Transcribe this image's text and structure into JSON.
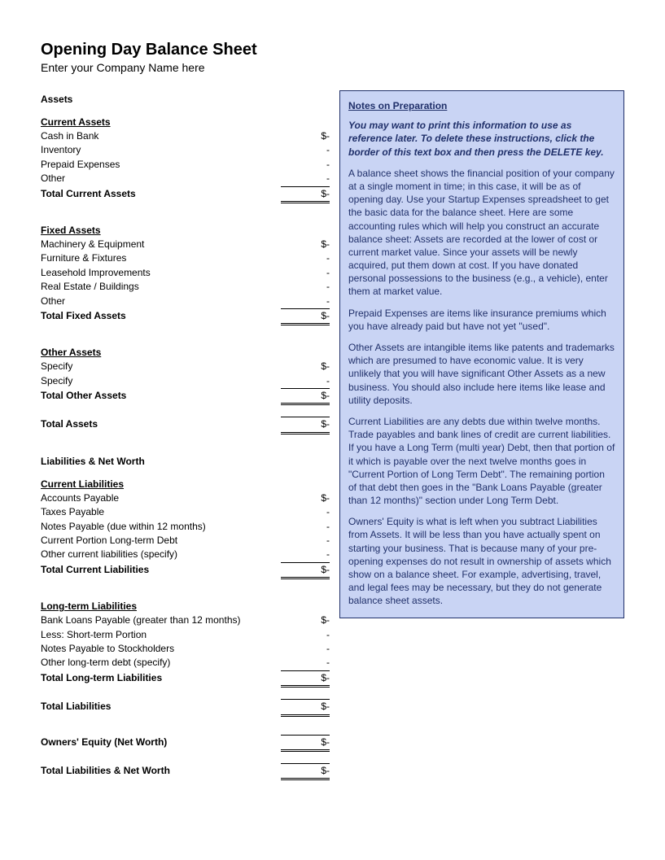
{
  "title": "Opening Day Balance Sheet",
  "subtitle": "Enter your Company Name here",
  "assets": {
    "heading": "Assets",
    "current": {
      "heading": "Current Assets",
      "items": [
        {
          "label": "Cash in Bank",
          "value": "$-"
        },
        {
          "label": "Inventory",
          "value": "-"
        },
        {
          "label": "Prepaid Expenses",
          "value": "-"
        },
        {
          "label": "Other",
          "value": "-"
        }
      ],
      "total_label": "Total Current Assets",
      "total_value": "$-"
    },
    "fixed": {
      "heading": "Fixed Assets",
      "items": [
        {
          "label": "Machinery & Equipment",
          "value": "$-"
        },
        {
          "label": "Furniture & Fixtures",
          "value": "-"
        },
        {
          "label": "Leasehold Improvements",
          "value": "-"
        },
        {
          "label": "Real Estate / Buildings",
          "value": "-"
        },
        {
          "label": "Other",
          "value": "-"
        }
      ],
      "total_label": "Total Fixed Assets",
      "total_value": "$-"
    },
    "other": {
      "heading": "Other Assets",
      "items": [
        {
          "label": "Specify",
          "value": "$-"
        },
        {
          "label": "Specify",
          "value": "-"
        }
      ],
      "total_label": "Total Other Assets",
      "total_value": "$-"
    },
    "total_label": "Total Assets",
    "total_value": "$-"
  },
  "liabilities": {
    "heading": "Liabilities & Net Worth",
    "current": {
      "heading": "Current Liabilities",
      "items": [
        {
          "label": "Accounts Payable",
          "value": "$-"
        },
        {
          "label": "Taxes Payable",
          "value": "-"
        },
        {
          "label": "Notes Payable (due within 12 months)",
          "value": "-"
        },
        {
          "label": "Current Portion Long-term Debt",
          "value": "-"
        },
        {
          "label": "Other current liabilities (specify)",
          "value": "-"
        }
      ],
      "total_label": "Total Current Liabilities",
      "total_value": "$-"
    },
    "long": {
      "heading": "Long-term Liabilities",
      "items": [
        {
          "label": "Bank Loans Payable (greater than 12 months)",
          "value": "$-"
        },
        {
          "label": "Less: Short-term Portion",
          "value": "-"
        },
        {
          "label": "Notes Payable to Stockholders",
          "value": "-"
        },
        {
          "label": "Other long-term debt (specify)",
          "value": "-"
        }
      ],
      "total_label": "Total Long-term Liabilities",
      "total_value": "$-"
    },
    "total_label": "Total Liabilities",
    "total_value": "$-",
    "equity_label": "Owners' Equity (Net Worth)",
    "equity_value": "$-",
    "grand_label": "Total Liabilities & Net Worth",
    "grand_value": "$-"
  },
  "notes": {
    "title": "Notes on Preparation",
    "intro": "You may want to print this information to use as reference later. To delete these instructions, click the border of this text box and then press the DELETE key.",
    "p1": "A balance sheet shows the financial position of your company at a single moment in time; in this case, it will be as of opening day. Use your Startup Expenses spreadsheet to get the basic data for the balance sheet. Here are some accounting rules which will help you construct an accurate balance sheet: Assets are recorded at the lower of cost or current market value. Since your assets will be newly acquired, put them down at cost. If you have donated personal possessions to the business (e.g., a vehicle), enter them at market value.",
    "p2": "Prepaid Expenses are items like insurance premiums which you have already paid but have not yet \"used\".",
    "p3": "Other Assets are intangible items like patents and trademarks which are presumed to have economic value. It is very unlikely that you will have significant Other Assets as a new business. You should also include here items like lease and utility deposits.",
    "p4": "Current Liabilities are any debts due within twelve months.",
    "p5": "Trade payables and bank lines of credit are current liabilities. If you have a Long Term (multi year) Debt, then that portion of it which is payable over the next twelve months goes in \"Current Portion of Long Term Debt\". The remaining portion of that debt then goes in the \"Bank Loans Payable (greater than 12 months)\" section under Long Term Debt.",
    "p6": "Owners' Equity is what is left when you subtract Liabilities from Assets. It will be less than you have actually spent on starting your business. That is because many of your pre-opening expenses do not result in ownership of assets which show on a balance sheet. For example, advertising, travel, and legal fees may be necessary, but they do not generate balance sheet assets."
  }
}
